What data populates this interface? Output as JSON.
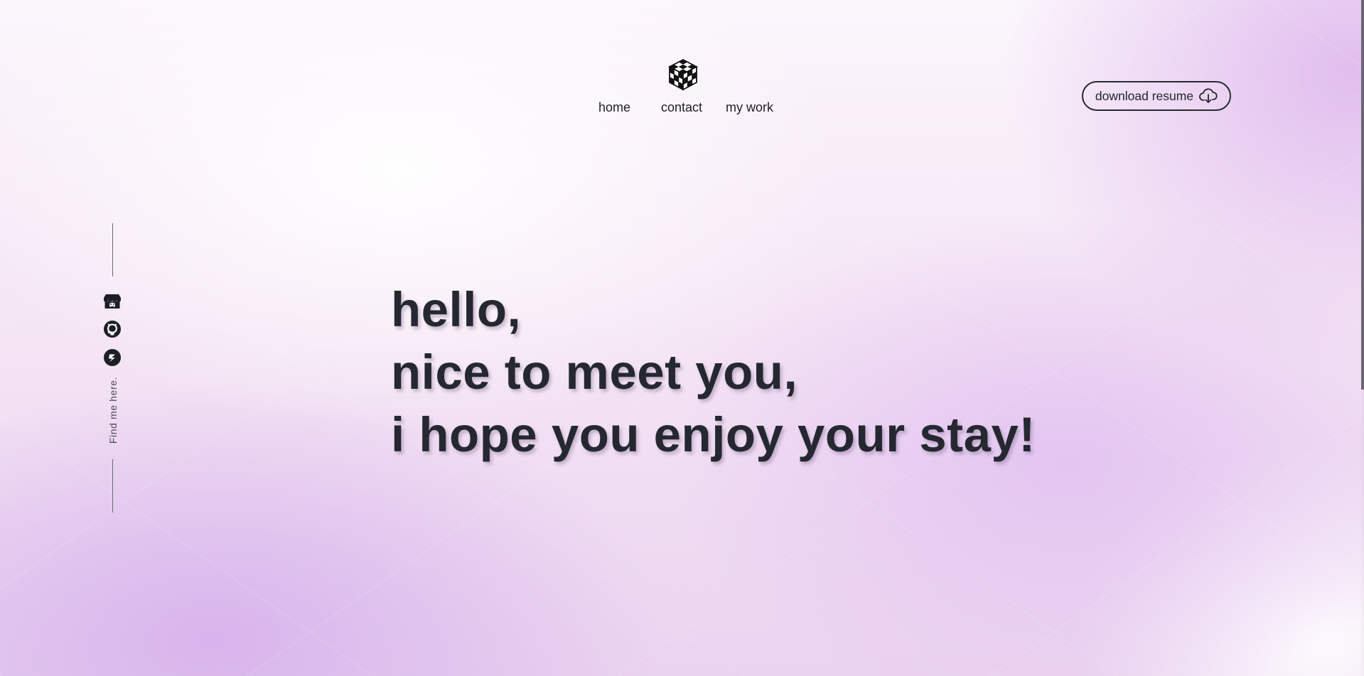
{
  "header": {
    "logo_icon": "rubiks-cube-icon",
    "nav": [
      {
        "label": "home"
      },
      {
        "label": "contact"
      },
      {
        "label": "my work"
      }
    ],
    "resume_button": {
      "label": "download resume",
      "icon": "cloud-download-icon"
    }
  },
  "sidebar": {
    "social_links": [
      {
        "icon": "itch-io-icon"
      },
      {
        "icon": "github-icon"
      },
      {
        "icon": "dribbble-icon"
      }
    ],
    "caption": "Find me here."
  },
  "hero": {
    "lines": [
      "hello,",
      "nice to meet you,",
      "i hope you enjoy your stay!"
    ]
  },
  "colors": {
    "text": "#252830",
    "accent_background": "#ead3ef",
    "button_border": "#2a2a33"
  }
}
